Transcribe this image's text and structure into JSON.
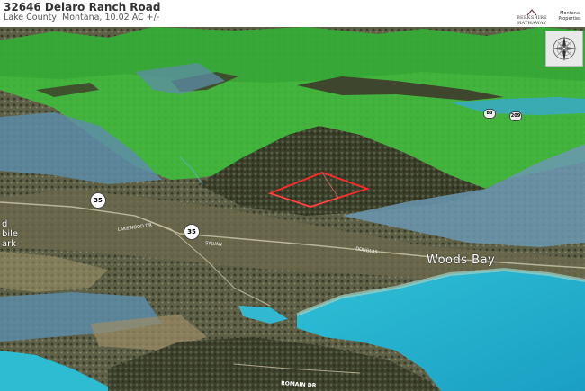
{
  "header": {
    "title": "32646 Delaro Ranch Road",
    "subtitle": "Lake County, Montana, 10.02 AC +/-",
    "brand_logo_text": "BERKSHIRE HATHAWAY",
    "brand_partner_text": "Montana Properties"
  },
  "map": {
    "place_label": "Woods Bay",
    "park_label_lines": [
      "d",
      "bile",
      "ark"
    ],
    "route_shield_1": "35",
    "route_shield_2": "35",
    "small_shield_1": "83",
    "small_shield_2": "209",
    "road_label_lakewood": "LAKEWOOD DR",
    "road_label_romain": "ROMAIN DR",
    "road_label_2": "SYLVAN",
    "road_label_3": "DOUGLAS"
  },
  "colors": {
    "parcel_outline": "#ff2a2a",
    "forest_green_overlay": "#3cbf3c",
    "lake_water": "#1aa6c8",
    "blue_gray_overlay": "#5d8ca8",
    "terrain_dark": "#3d3a2a"
  },
  "icons": [
    "compass-rose-icon"
  ]
}
